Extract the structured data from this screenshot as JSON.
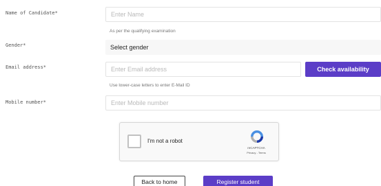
{
  "form": {
    "name": {
      "label": "Name of Candidate*",
      "placeholder": "Enter Name",
      "hint": "As per the qualifying examination"
    },
    "gender": {
      "label": "Gender*",
      "selected": "Select gender"
    },
    "email": {
      "label": "Email address*",
      "placeholder": "Enter Email address",
      "hint": "Use lower-case letters to enter E-Mail ID",
      "check_label": "Check availability"
    },
    "mobile": {
      "label": "Mobile number*",
      "placeholder": "Enter Mobile number"
    }
  },
  "captcha": {
    "label": "I'm not a robot",
    "brand": "reCAPTCHA",
    "links": "Privacy - Terms",
    "checked": false,
    "logo_icon": "recaptcha-icon"
  },
  "actions": {
    "back_label": "Back to home",
    "register_label": "Register student"
  },
  "colors": {
    "accent": "#5b3dc7",
    "select_bg": "#f7f7f7",
    "field_border": "#e3e3e3"
  }
}
